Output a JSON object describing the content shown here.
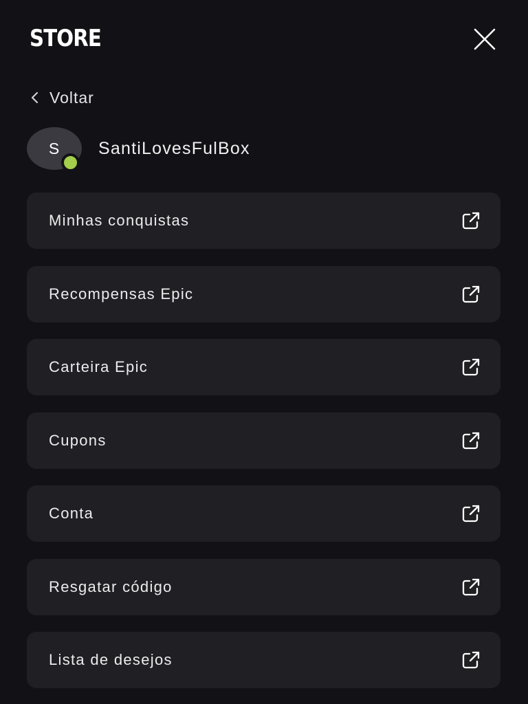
{
  "header": {
    "brand": "STORE",
    "close_icon": "close-icon"
  },
  "nav": {
    "back_label": "Voltar",
    "back_icon": "chevron-left-icon"
  },
  "user": {
    "avatar_initial": "S",
    "username": "SantiLovesFulBox",
    "status_color": "#a3cf4a"
  },
  "menu": {
    "items": [
      {
        "label": "Minhas conquistas",
        "icon": "external-link-icon"
      },
      {
        "label": "Recompensas Epic",
        "icon": "external-link-icon"
      },
      {
        "label": "Carteira Epic",
        "icon": "external-link-icon"
      },
      {
        "label": "Cupons",
        "icon": "external-link-icon"
      },
      {
        "label": "Conta",
        "icon": "external-link-icon"
      },
      {
        "label": "Resgatar código",
        "icon": "external-link-icon"
      },
      {
        "label": "Lista de desejos",
        "icon": "external-link-icon"
      }
    ]
  }
}
